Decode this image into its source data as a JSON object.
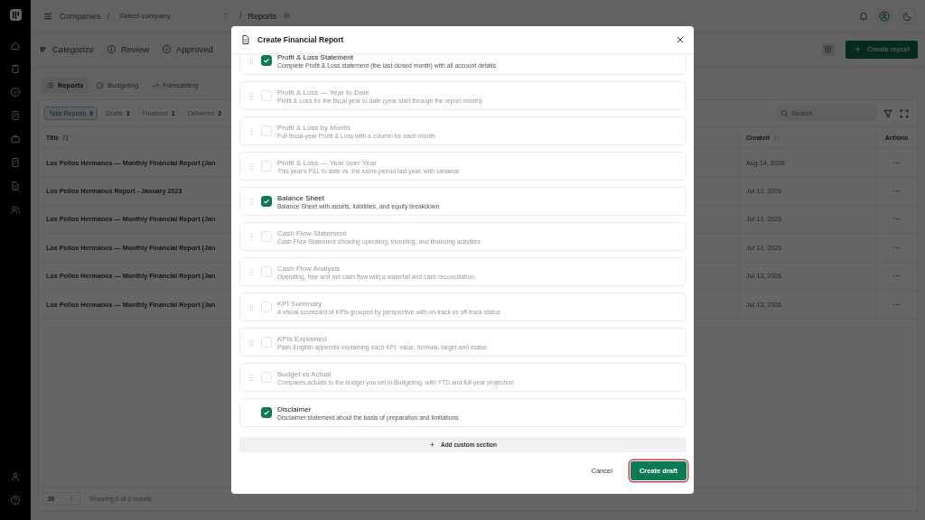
{
  "header": {
    "breadcrumb": [
      "Companies",
      "Select company",
      "Reports"
    ],
    "separators": [
      "/",
      "/"
    ]
  },
  "workflow_tabs": [
    "Categorize",
    "Review",
    "Approved"
  ],
  "create_report_button": "Create report",
  "view_tabs": [
    {
      "label": "Reports",
      "selected": true
    },
    {
      "label": "Budgeting",
      "selected": false
    },
    {
      "label": "Forecasting",
      "selected": false
    }
  ],
  "stats": [
    {
      "label": "Total Reports",
      "count": "6",
      "selected": true
    },
    {
      "label": "Drafts",
      "count": "3",
      "selected": false
    },
    {
      "label": "Finalized",
      "count": "1",
      "selected": false
    },
    {
      "label": "Delivered",
      "count": "2",
      "selected": false
    }
  ],
  "search": {
    "placeholder": "Search"
  },
  "table": {
    "columns": [
      "Title",
      "Created",
      "Actions"
    ],
    "rows": [
      {
        "title": "Los Pollos Hermanos — Monthly Financial Report (Jan",
        "created": "Aug 14, 2026"
      },
      {
        "title": "Los Pollos Hermanos Report - January 2023",
        "created": "Jul 13, 2026"
      },
      {
        "title": "Los Pollos Hermanos — Monthly Financial Report (Jan",
        "created": "Jul 13, 2026"
      },
      {
        "title": "Los Pollos Hermanos — Monthly Financial Report (Jan",
        "created": "Jul 13, 2026"
      },
      {
        "title": "Los Pollos Hermanos — Monthly Financial Report (Jan",
        "created": "Jul 13, 2026"
      },
      {
        "title": "Los Pollos Hermanos — Monthly Financial Report (Jan",
        "created": "Jul 13, 2026"
      }
    ]
  },
  "pagination": {
    "page_size": "20",
    "summary": "Showing 6 of 6 results"
  },
  "dialog": {
    "title": "Create Financial Report",
    "sections": [
      {
        "title": "Profit & Loss Statement",
        "description": "Complete Profit & Loss statement (the last closed month) with all account details",
        "checked": true,
        "draggable": true
      },
      {
        "title": "Profit & Loss — Year to Date",
        "description": "Profit & Loss for the fiscal year to date (year start through the report month)",
        "checked": false,
        "draggable": true
      },
      {
        "title": "Profit & Loss by Month",
        "description": "Full fiscal-year Profit & Loss with a column for each month",
        "checked": false,
        "draggable": true
      },
      {
        "title": "Profit & Loss — Year over Year",
        "description": "This year's P&L to date vs. the same period last year, with variance",
        "checked": false,
        "draggable": true
      },
      {
        "title": "Balance Sheet",
        "description": "Balance Sheet with assets, liabilities, and equity breakdown",
        "checked": true,
        "draggable": true
      },
      {
        "title": "Cash Flow Statement",
        "description": "Cash Flow Statement showing operating, investing, and financing activities",
        "checked": false,
        "draggable": true
      },
      {
        "title": "Cash Flow Analysis",
        "description": "Operating, free and net cash flow with a waterfall and cash reconciliation",
        "checked": false,
        "draggable": true
      },
      {
        "title": "KPI Summary",
        "description": "A visual scorecard of KPIs grouped by perspective with on-track vs off-track status",
        "checked": false,
        "draggable": true
      },
      {
        "title": "KPIs Explained",
        "description": "Plain-English appendix explaining each KPI: value, formula, target and status",
        "checked": false,
        "draggable": true
      },
      {
        "title": "Budget vs Actual",
        "description": "Compares actuals to the budget you set in Budgeting, with YTD and full-year projection",
        "checked": false,
        "draggable": true
      },
      {
        "title": "Disclaimer",
        "description": "Disclaimer statement about the basis of preparation and limitations",
        "checked": true,
        "draggable": false
      }
    ],
    "add_button": "Add custom section",
    "cancel_button": "Cancel",
    "confirm_button": {
      "label": "Create draft",
      "focused": true
    }
  }
}
